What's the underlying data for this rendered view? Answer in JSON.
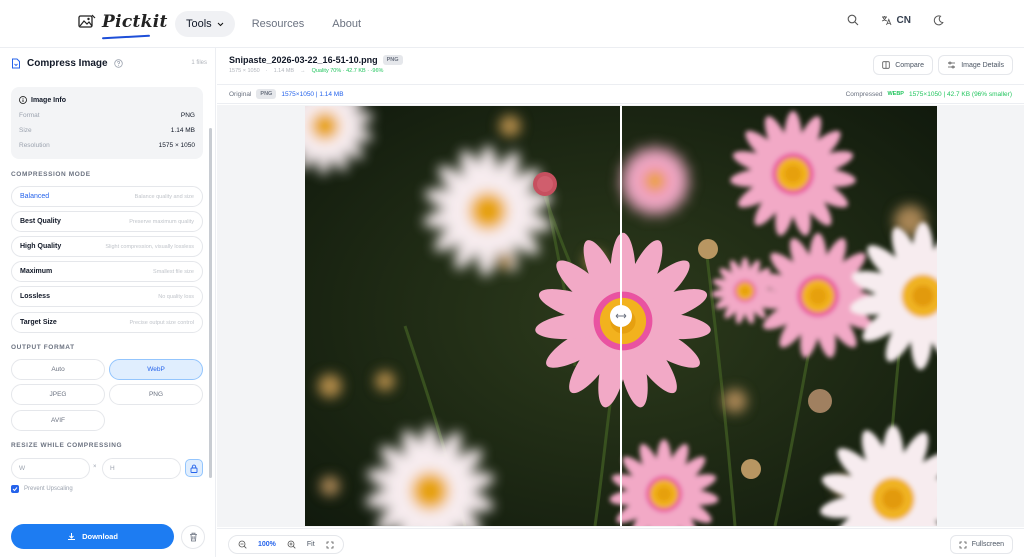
{
  "app": {
    "logo_text": "Pictkit"
  },
  "nav": {
    "tools": "Tools",
    "resources": "Resources",
    "about": "About",
    "language": "CN"
  },
  "sidebar": {
    "title": "Compress Image",
    "file_count": "1 files",
    "info": {
      "title": "Image Info",
      "format_label": "Format",
      "format_value": "PNG",
      "size_label": "Size",
      "size_value": "1.14 MB",
      "resolution_label": "Resolution",
      "resolution_value": "1575 × 1050"
    },
    "compression_mode_label": "COMPRESSION MODE",
    "modes": [
      {
        "name": "Balanced",
        "desc": "Balance quality and size"
      },
      {
        "name": "Best Quality",
        "desc": "Preserve maximum quality"
      },
      {
        "name": "High Quality",
        "desc": "Slight compression, visually lossless"
      },
      {
        "name": "Maximum",
        "desc": "Smallest file size"
      },
      {
        "name": "Lossless",
        "desc": "No quality loss"
      },
      {
        "name": "Target Size",
        "desc": "Precise output size control"
      }
    ],
    "output_format_label": "OUTPUT FORMAT",
    "formats": [
      "Auto",
      "WebP",
      "JPEG",
      "PNG",
      "AVIF"
    ],
    "resize_label": "RESIZE WHILE COMPRESSING",
    "width_placeholder": "W",
    "height_placeholder": "H",
    "resize_separator": "×",
    "prevent_upscaling": "Prevent Upscaling",
    "download": "Download"
  },
  "main": {
    "file_name": "Snipaste_2026-03-22_16-51-10.png",
    "file_badge": "PNG",
    "meta_resolution": "1575 × 1050",
    "meta_dot1": "·",
    "meta_size": "1.14 MB",
    "meta_arrow": "→",
    "meta_result": "Quality 70% · 42.7 KB · -96%",
    "compare_btn": "Compare",
    "details_btn": "Image Details",
    "original_label": "Original",
    "original_badge": "PNG",
    "original_info": "1575×1050 | 1.14 MB",
    "compressed_label": "Compressed",
    "compressed_badge": "WEBP",
    "compressed_info": "1575×1050 | 42.7 KB (96% smaller)",
    "zoom": "100%",
    "fit": "Fit",
    "fullscreen": "Fullscreen"
  },
  "colors": {
    "accent": "#2563eb",
    "download_button": "#1d7cf2",
    "success": "#22c55e"
  }
}
